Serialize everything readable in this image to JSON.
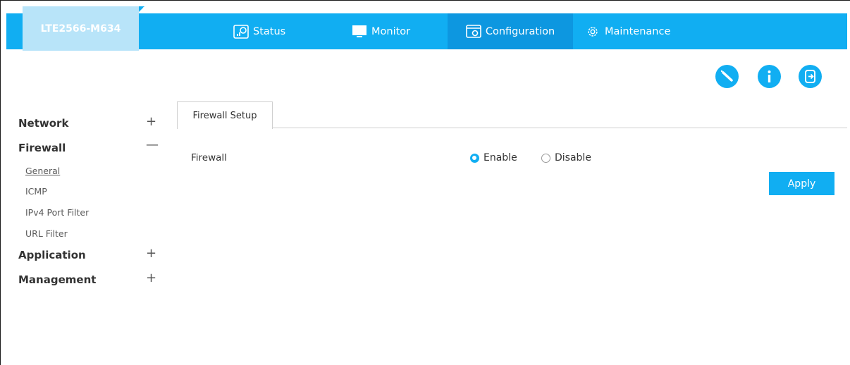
{
  "header": {
    "device_name": "LTE2566-M634",
    "nav": [
      {
        "label": "Status",
        "icon": "chart-window-icon"
      },
      {
        "label": "Monitor",
        "icon": "monitor-icon"
      },
      {
        "label": "Configuration",
        "icon": "config-window-icon"
      },
      {
        "label": "Maintenance",
        "icon": "gear-icon"
      }
    ],
    "actions": [
      "wizard-icon",
      "info-icon",
      "logout-icon"
    ]
  },
  "sidebar": {
    "groups": [
      {
        "label": "Network",
        "sign": "+"
      },
      {
        "label": "Firewall",
        "sign": "—",
        "items": [
          "General",
          "ICMP",
          "IPv4 Port Filter",
          "URL Filter"
        ]
      },
      {
        "label": "Application",
        "sign": "+"
      },
      {
        "label": "Management",
        "sign": "+"
      }
    ]
  },
  "main": {
    "tab": "Firewall Setup",
    "field_label": "Firewall",
    "options": [
      {
        "label": "Enable",
        "selected": true
      },
      {
        "label": "Disable",
        "selected": false
      }
    ],
    "apply_label": "Apply"
  },
  "colors": {
    "accent": "#11aef2",
    "active_nav": "#0d97e0",
    "logo_bg": "#b8e4f9"
  }
}
